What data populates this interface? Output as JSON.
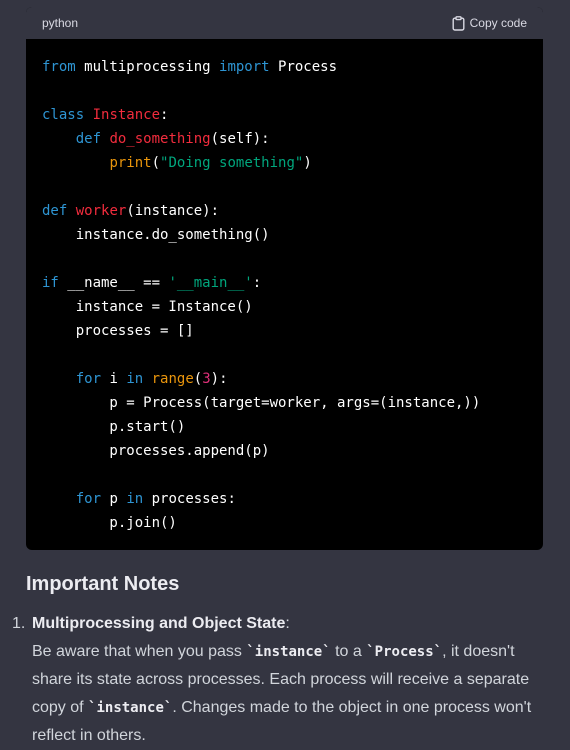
{
  "code_block": {
    "language": "python",
    "copy_label": "Copy code",
    "lines": [
      [
        {
          "t": "from",
          "c": "kw"
        },
        {
          "t": " multiprocessing "
        },
        {
          "t": "import",
          "c": "kw"
        },
        {
          "t": " Process"
        }
      ],
      [],
      [
        {
          "t": "class",
          "c": "kw"
        },
        {
          "t": " "
        },
        {
          "t": "Instance",
          "c": "fn"
        },
        {
          "t": ":"
        }
      ],
      [
        {
          "t": "    "
        },
        {
          "t": "def",
          "c": "kw"
        },
        {
          "t": " "
        },
        {
          "t": "do_something",
          "c": "fn"
        },
        {
          "t": "(self):"
        }
      ],
      [
        {
          "t": "        "
        },
        {
          "t": "print",
          "c": "bi"
        },
        {
          "t": "("
        },
        {
          "t": "\"Doing something\"",
          "c": "str"
        },
        {
          "t": ")"
        }
      ],
      [],
      [
        {
          "t": "def",
          "c": "kw"
        },
        {
          "t": " "
        },
        {
          "t": "worker",
          "c": "fn"
        },
        {
          "t": "(instance):"
        }
      ],
      [
        {
          "t": "    instance.do_something()"
        }
      ],
      [],
      [
        {
          "t": "if",
          "c": "kw"
        },
        {
          "t": " __name__ == "
        },
        {
          "t": "'__main__'",
          "c": "str"
        },
        {
          "t": ":"
        }
      ],
      [
        {
          "t": "    instance = Instance()"
        }
      ],
      [
        {
          "t": "    processes = []"
        }
      ],
      [],
      [
        {
          "t": "    "
        },
        {
          "t": "for",
          "c": "kw"
        },
        {
          "t": " i "
        },
        {
          "t": "in",
          "c": "kw"
        },
        {
          "t": " "
        },
        {
          "t": "range",
          "c": "bi"
        },
        {
          "t": "("
        },
        {
          "t": "3",
          "c": "num"
        },
        {
          "t": "):"
        }
      ],
      [
        {
          "t": "        p = Process(target=worker, args=(instance,))"
        }
      ],
      [
        {
          "t": "        p.start()"
        }
      ],
      [
        {
          "t": "        processes.append(p)"
        }
      ],
      [],
      [
        {
          "t": "    "
        },
        {
          "t": "for",
          "c": "kw"
        },
        {
          "t": " p "
        },
        {
          "t": "in",
          "c": "kw"
        },
        {
          "t": " processes:"
        }
      ],
      [
        {
          "t": "        p.join()"
        }
      ]
    ]
  },
  "notes": {
    "title": "Important Notes",
    "items": [
      {
        "number": "1.",
        "title": "Multiprocessing and Object State",
        "title_suffix": ":",
        "body": [
          {
            "t": "Be aware that when you pass "
          },
          {
            "t": "`instance`",
            "code": true
          },
          {
            "t": " to a "
          },
          {
            "t": "`Process`",
            "code": true
          },
          {
            "t": ", it doesn't share its state across processes. Each process will receive a separate copy of "
          },
          {
            "t": "`instance`",
            "code": true
          },
          {
            "t": ". Changes made to the object in one process won't reflect in others."
          }
        ]
      }
    ]
  }
}
